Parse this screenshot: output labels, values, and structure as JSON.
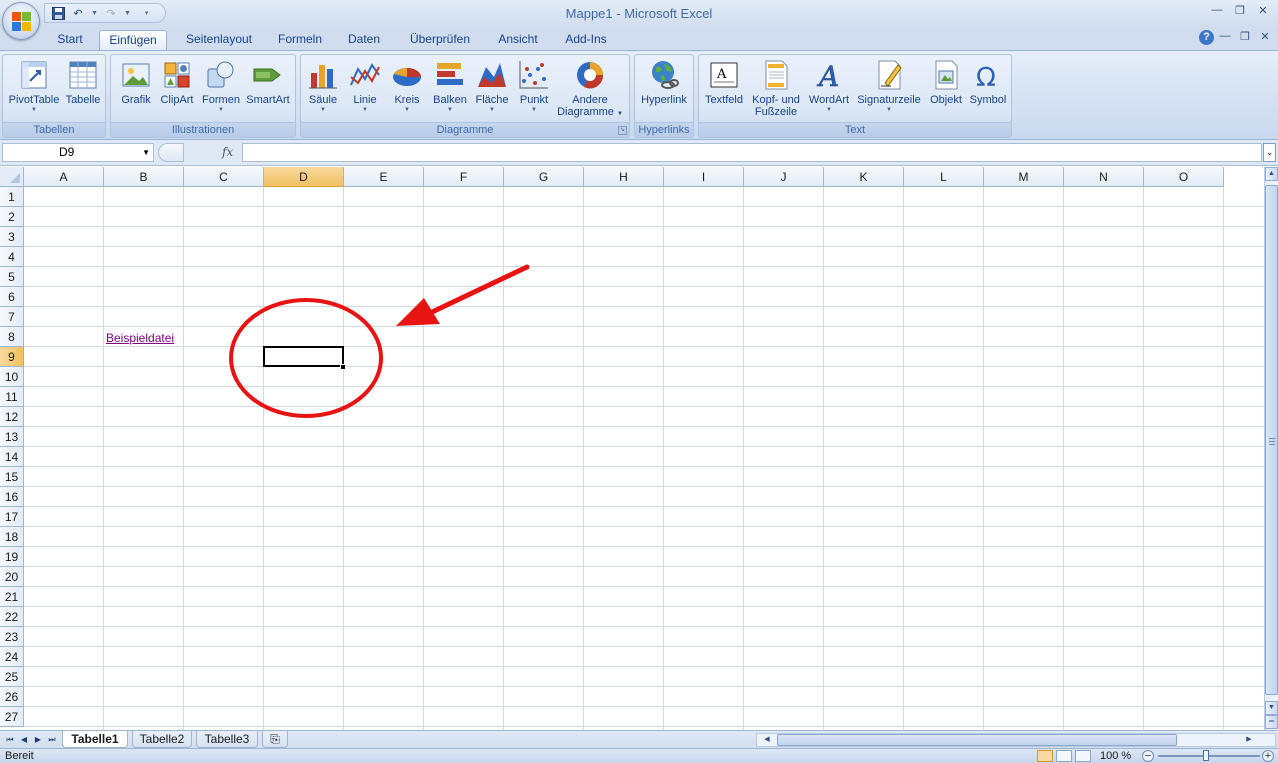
{
  "window": {
    "title": "Mappe1 - Microsoft Excel"
  },
  "tabs": [
    "Start",
    "Einfügen",
    "Seitenlayout",
    "Formeln",
    "Daten",
    "Überprüfen",
    "Ansicht",
    "Add-Ins"
  ],
  "active_tab": "Einfügen",
  "ribbon": {
    "groups": [
      {
        "label": "Tabellen",
        "buttons": [
          "PivotTable",
          "Tabelle"
        ]
      },
      {
        "label": "Illustrationen",
        "buttons": [
          "Grafik",
          "ClipArt",
          "Formen",
          "SmartArt"
        ]
      },
      {
        "label": "Diagramme",
        "buttons": [
          "Säule",
          "Linie",
          "Kreis",
          "Balken",
          "Fläche",
          "Punkt",
          "Andere",
          "Diagramme"
        ]
      },
      {
        "label": "Hyperlinks",
        "buttons": [
          "Hyperlink"
        ]
      },
      {
        "label": "Text",
        "buttons": [
          "Textfeld",
          "Kopf- und",
          "Fußzeile",
          "WordArt",
          "Signaturzeile",
          "Objekt",
          "Symbol"
        ]
      }
    ]
  },
  "formula_bar": {
    "name_box": "D9",
    "fx_label": "fx",
    "formula": ""
  },
  "grid": {
    "columns": [
      "A",
      "B",
      "C",
      "D",
      "E",
      "F",
      "G",
      "H",
      "I",
      "J",
      "K",
      "L",
      "M",
      "N",
      "O"
    ],
    "rows": [
      "1",
      "2",
      "3",
      "4",
      "5",
      "6",
      "7",
      "8",
      "9",
      "10",
      "11",
      "12",
      "13",
      "14",
      "15",
      "16",
      "17",
      "18",
      "19",
      "20",
      "21",
      "22",
      "23",
      "24",
      "25",
      "26",
      "27"
    ],
    "selected_column": "D",
    "selected_row": "9",
    "hyperlink_cell": {
      "ref": "B8",
      "text": "Beispieldatei"
    }
  },
  "annotation": {
    "color": "#e81313"
  },
  "sheets": {
    "tabs": [
      "Tabelle1",
      "Tabelle2",
      "Tabelle3"
    ],
    "active": "Tabelle1"
  },
  "status": {
    "text": "Bereit",
    "zoom": "100 %"
  },
  "colors": {
    "accent": "#15428b",
    "selection_header": "#f1c15f",
    "hyperlink": "#800080"
  }
}
